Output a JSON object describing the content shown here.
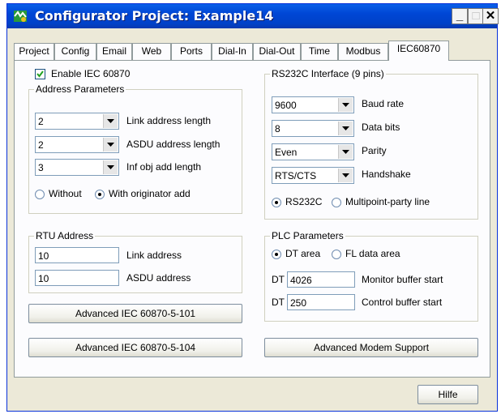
{
  "window": {
    "title": "Configurator Project: Example14"
  },
  "tabs": [
    "Project",
    "Config",
    "Email",
    "Web",
    "Ports",
    "Dial-In",
    "Dial-Out",
    "Time",
    "Modbus",
    "IEC60870"
  ],
  "enable": {
    "label": "Enable IEC 60870",
    "checked": true
  },
  "address_params": {
    "title": "Address Parameters",
    "rows": [
      {
        "value": "2",
        "label": "Link address length"
      },
      {
        "value": "2",
        "label": "ASDU address length"
      },
      {
        "value": "3",
        "label": "Inf obj add length"
      }
    ],
    "radio_without": "Without",
    "radio_with": "With originator add",
    "selected": "with"
  },
  "rtu": {
    "title": "RTU Address",
    "link_value": "10",
    "link_label": "Link address",
    "asdu_value": "10",
    "asdu_label": "ASDU address"
  },
  "rs232": {
    "title": "RS232C Interface (9 pins)",
    "rows": [
      {
        "value": "9600",
        "label": "Baud rate"
      },
      {
        "value": "8",
        "label": "Data bits"
      },
      {
        "value": "Even",
        "label": "Parity"
      },
      {
        "value": "RTS/CTS",
        "label": "Handshake"
      }
    ],
    "radio_rs232c": "RS232C",
    "radio_multipoint": "Multipoint-party line",
    "selected": "rs232c"
  },
  "plc": {
    "title": "PLC Parameters",
    "radio_dt": "DT area",
    "radio_fl": "FL data area",
    "selected": "dt",
    "monitor_prefix": "DT",
    "monitor_value": "4026",
    "monitor_label": "Monitor buffer start",
    "control_prefix": "DT",
    "control_value": "250",
    "control_label": "Control buffer start"
  },
  "buttons": {
    "adv101": "Advanced IEC 60870-5-101",
    "adv104": "Advanced IEC 60870-5-104",
    "modem": "Advanced Modem Support",
    "help": "Hilfe"
  }
}
